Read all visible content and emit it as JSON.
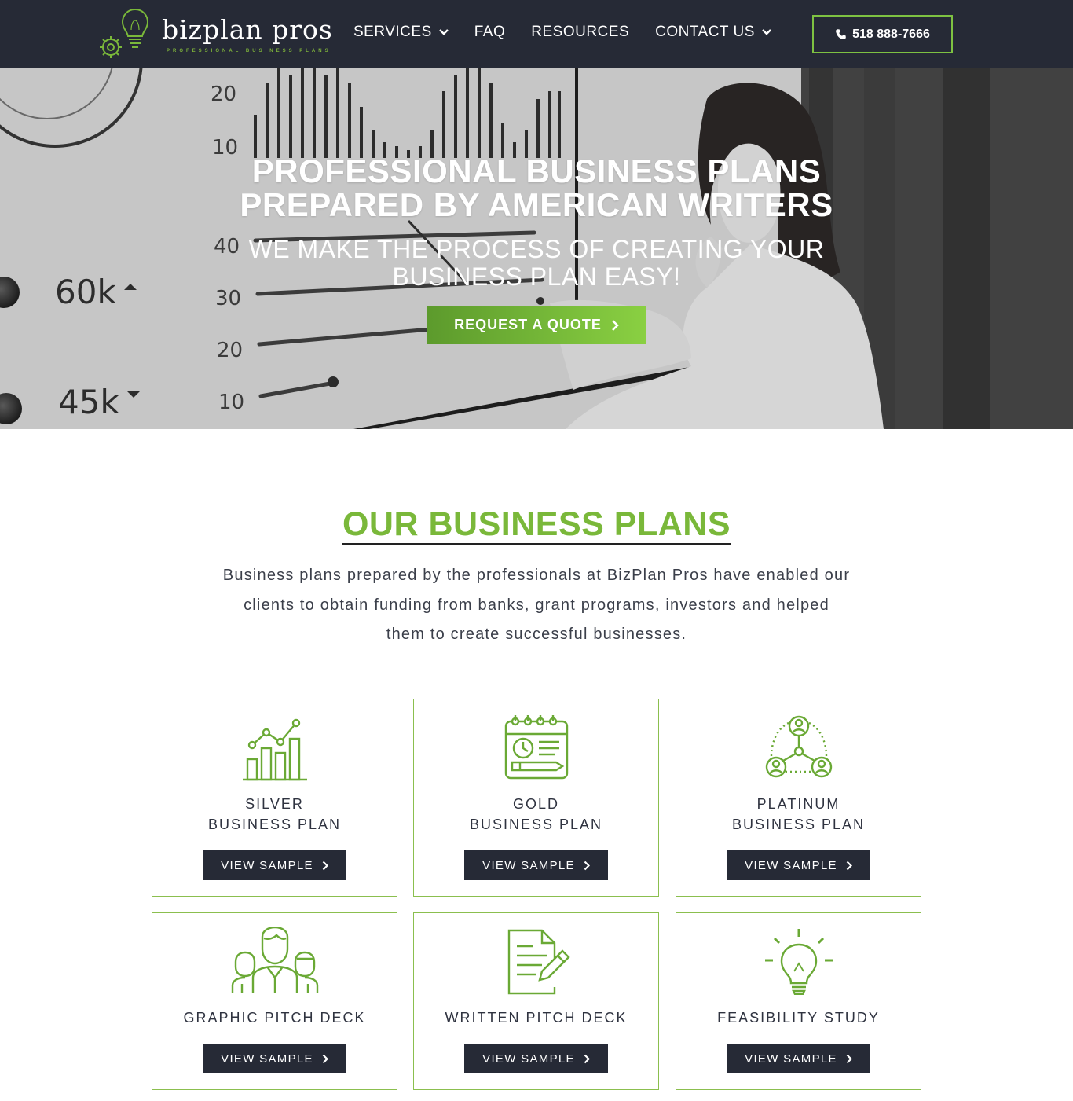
{
  "brand": {
    "name": "bizplan pros",
    "tagline": "PROFESSIONAL BUSINESS PLANS",
    "green": "#7ab83a",
    "dark": "#262a36"
  },
  "nav": {
    "items": [
      {
        "label": "SERVICES",
        "has_dropdown": true
      },
      {
        "label": "FAQ",
        "has_dropdown": false
      },
      {
        "label": "RESOURCES",
        "has_dropdown": false
      },
      {
        "label": "CONTACT US",
        "has_dropdown": true
      }
    ],
    "phone": "518 888-7666",
    "phone_icon": "phone-icon"
  },
  "hero": {
    "title_line1": "PROFESSIONAL BUSINESS PLANS",
    "title_line2": "PREPARED BY AMERICAN WRITERS",
    "subtitle_line1": "WE MAKE THE PROCESS OF CREATING YOUR",
    "subtitle_line2": "BUSINESS PLAN EASY!",
    "cta": "REQUEST A QUOTE",
    "bg_chart_labels": [
      "20",
      "10",
      "40",
      "30",
      "20",
      "10",
      "60k",
      "45k"
    ]
  },
  "plans": {
    "heading": "OUR BUSINESS PLANS",
    "intro": "Business plans prepared by the professionals at BizPlan Pros have enabled our clients to obtain funding from banks, grant programs, investors and helped them to create successful businesses.",
    "button_label": "VIEW SAMPLE",
    "cards": [
      {
        "line1": "SILVER",
        "line2": "BUSINESS PLAN",
        "icon": "growth-chart-icon"
      },
      {
        "line1": "GOLD",
        "line2": "BUSINESS PLAN",
        "icon": "calendar-planning-icon"
      },
      {
        "line1": "PLATINUM",
        "line2": "BUSINESS PLAN",
        "icon": "team-network-icon"
      },
      {
        "line1": "GRAPHIC PITCH DECK",
        "line2": "",
        "icon": "people-group-icon"
      },
      {
        "line1": "WRITTEN PITCH DECK",
        "line2": "",
        "icon": "document-pen-icon"
      },
      {
        "line1": "FEASIBILITY STUDY",
        "line2": "",
        "icon": "lightbulb-icon"
      }
    ]
  }
}
